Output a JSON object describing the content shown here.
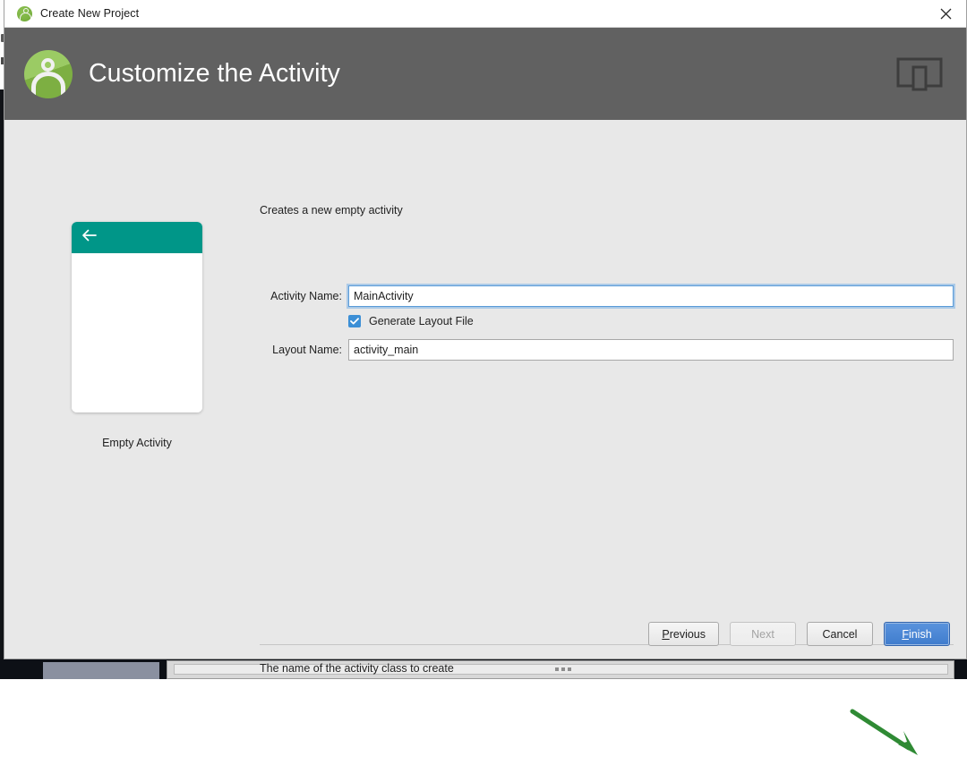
{
  "window": {
    "title": "Create New Project",
    "app_icon": "android-studio-icon",
    "close_icon": "close-icon"
  },
  "header": {
    "title": "Customize the Activity",
    "logo_icon": "android-studio-logo",
    "device_icon": "device-preview-icon",
    "background_color": "#616161"
  },
  "preview": {
    "label": "Empty Activity",
    "appbar_color": "#009688",
    "back_icon": "back-arrow-icon"
  },
  "form": {
    "description": "Creates a new empty activity",
    "activity_name": {
      "label": "Activity Name:",
      "value": "MainActivity",
      "placeholder": "MainActivity",
      "focused": true
    },
    "generate_layout": {
      "label": "Generate Layout File",
      "checked": true,
      "check_icon": "checkmark-icon",
      "color": "#3c8fd6"
    },
    "layout_name": {
      "label": "Layout Name:",
      "value": "activity_main",
      "placeholder": "activity_main",
      "focused": false
    },
    "help_text": "The name of the activity class to create"
  },
  "footer": {
    "previous": "Previous",
    "previous_mnemonic": "P",
    "next": "Next",
    "next_enabled": false,
    "cancel": "Cancel",
    "finish": "Finish",
    "finish_mnemonic": "F",
    "finish_is_default": true,
    "finish_color": "#4a86d8"
  },
  "annotation": {
    "arrow_icon": "green-pointer-arrow",
    "color": "#2f8a34",
    "points_to": "finish-button"
  }
}
